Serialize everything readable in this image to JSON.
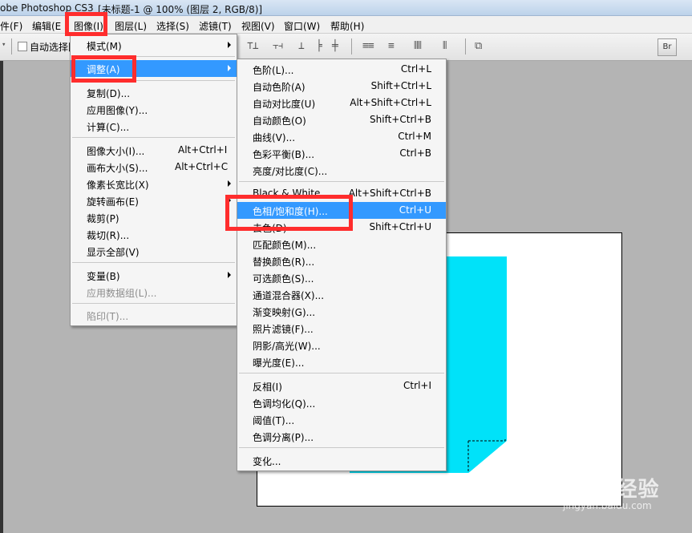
{
  "title": {
    "app": "obe Photoshop CS3",
    "doc": "[未标题-1 @ 100% (图层 2, RGB/8)]"
  },
  "menubar": {
    "items": [
      "件(F)",
      "编辑(E",
      "图像(I)",
      "图层(L)",
      "选择(S)",
      "滤镜(T)",
      "视图(V)",
      "窗口(W)",
      "帮助(H)"
    ]
  },
  "toolbar": {
    "auto_select": "自动选择图"
  },
  "image_menu": {
    "items": [
      {
        "label": "模式(M)",
        "shortcut": "",
        "submenu": true
      },
      {
        "label": "调整(A)",
        "shortcut": "",
        "submenu": true
      },
      {
        "label": "复制(D)...",
        "shortcut": ""
      },
      {
        "label": "应用图像(Y)...",
        "shortcut": ""
      },
      {
        "label": "计算(C)...",
        "shortcut": ""
      },
      {
        "label": "图像大小(I)...",
        "shortcut": "Alt+Ctrl+I"
      },
      {
        "label": "画布大小(S)...",
        "shortcut": "Alt+Ctrl+C"
      },
      {
        "label": "像素长宽比(X)",
        "shortcut": "",
        "submenu": true
      },
      {
        "label": "旋转画布(E)",
        "shortcut": "",
        "submenu": true
      },
      {
        "label": "裁剪(P)",
        "shortcut": ""
      },
      {
        "label": "裁切(R)...",
        "shortcut": ""
      },
      {
        "label": "显示全部(V)",
        "shortcut": ""
      },
      {
        "label": "变量(B)",
        "shortcut": "",
        "submenu": true
      },
      {
        "label": "应用数据组(L)...",
        "shortcut": "",
        "disabled": true
      },
      {
        "label": "陷印(T)...",
        "shortcut": "",
        "disabled": true
      }
    ]
  },
  "adjust_menu": {
    "items": [
      {
        "label": "色阶(L)...",
        "shortcut": "Ctrl+L"
      },
      {
        "label": "自动色阶(A)",
        "shortcut": "Shift+Ctrl+L"
      },
      {
        "label": "自动对比度(U)",
        "shortcut": "Alt+Shift+Ctrl+L"
      },
      {
        "label": "自动颜色(O)",
        "shortcut": "Shift+Ctrl+B"
      },
      {
        "label": "曲线(V)...",
        "shortcut": "Ctrl+M"
      },
      {
        "label": "色彩平衡(B)...",
        "shortcut": "Ctrl+B"
      },
      {
        "label": "亮度/对比度(C)...",
        "shortcut": ""
      },
      {
        "label": "Black & White...",
        "shortcut": "Alt+Shift+Ctrl+B"
      },
      {
        "label": "色相/饱和度(H)...",
        "shortcut": "Ctrl+U"
      },
      {
        "label": "去色(D)",
        "shortcut": "Shift+Ctrl+U"
      },
      {
        "label": "匹配颜色(M)...",
        "shortcut": ""
      },
      {
        "label": "替换颜色(R)...",
        "shortcut": ""
      },
      {
        "label": "可选颜色(S)...",
        "shortcut": ""
      },
      {
        "label": "通道混合器(X)...",
        "shortcut": ""
      },
      {
        "label": "渐变映射(G)...",
        "shortcut": ""
      },
      {
        "label": "照片滤镜(F)...",
        "shortcut": ""
      },
      {
        "label": "阴影/高光(W)...",
        "shortcut": ""
      },
      {
        "label": "曝光度(E)...",
        "shortcut": ""
      },
      {
        "label": "反相(I)",
        "shortcut": "Ctrl+I"
      },
      {
        "label": "色调均化(Q)...",
        "shortcut": ""
      },
      {
        "label": "阈值(T)...",
        "shortcut": ""
      },
      {
        "label": "色调分离(P)...",
        "shortcut": ""
      },
      {
        "label": "变化...",
        "shortcut": ""
      }
    ]
  },
  "watermark": {
    "logo": "Bai du 经验",
    "url": "jingyan.baidu.com"
  },
  "colors": {
    "highlight": "#3399ff",
    "annotation": "#ff2d2d",
    "cyan_shape": "#00e2f9"
  }
}
